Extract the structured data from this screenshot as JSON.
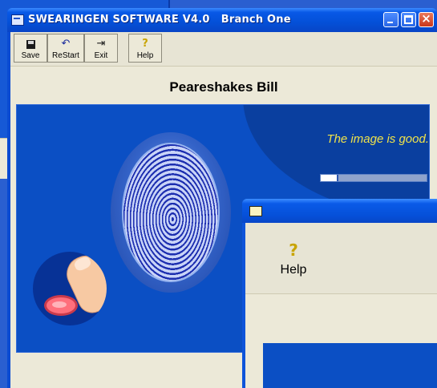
{
  "main_window": {
    "title": "SWEARINGEN SOFTWARE V4.0   Branch One",
    "toolbar": [
      {
        "label": "Save",
        "icon": "floppy-disk-icon"
      },
      {
        "label": "ReStart",
        "icon": "undo-arrow-icon"
      },
      {
        "label": "Exit",
        "icon": "exit-door-icon"
      },
      {
        "label": "Help",
        "icon": "question-mark-icon"
      }
    ],
    "person_name": "Peareshakes  Bill",
    "scan": {
      "status_text": "The image is good.",
      "quality_progress": 0.15
    }
  },
  "dialog": {
    "title": "",
    "help_label": "Help"
  },
  "colors": {
    "titlebar": "#0450d8",
    "panel_blue": "#0b4fc4",
    "status_yellow": "#f0e34a",
    "toolbar_bg": "#ece9d8"
  }
}
